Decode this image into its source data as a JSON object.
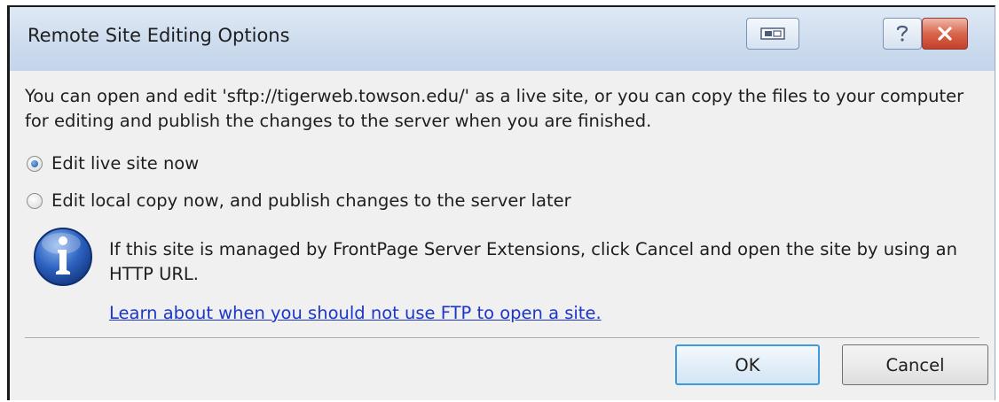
{
  "window": {
    "title": "Remote Site Editing Options"
  },
  "message": "You can open and edit 'sftp://tigerweb.towson.edu/' as a live site, or you can copy the files to your computer for editing and publish the changes to the server when you are finished.",
  "options": [
    {
      "label": "Edit live site now",
      "selected": true
    },
    {
      "label": "Edit local copy now, and publish changes to the server later",
      "selected": false
    }
  ],
  "info": {
    "text": "If this site is managed by FrontPage Server Extensions, click Cancel and open the site by using an HTTP URL.",
    "link": "Learn about when you should not use FTP to open a site."
  },
  "buttons": {
    "ok": "OK",
    "cancel": "Cancel"
  },
  "colors": {
    "link": "#1c36c8",
    "default_button_border": "#3c9bd8",
    "close_button": "#c44128",
    "info_icon": "#1f4fa8"
  },
  "icons": {
    "restore": "restore-icon",
    "help": "help-icon",
    "close": "close-icon",
    "info": "info-icon"
  }
}
